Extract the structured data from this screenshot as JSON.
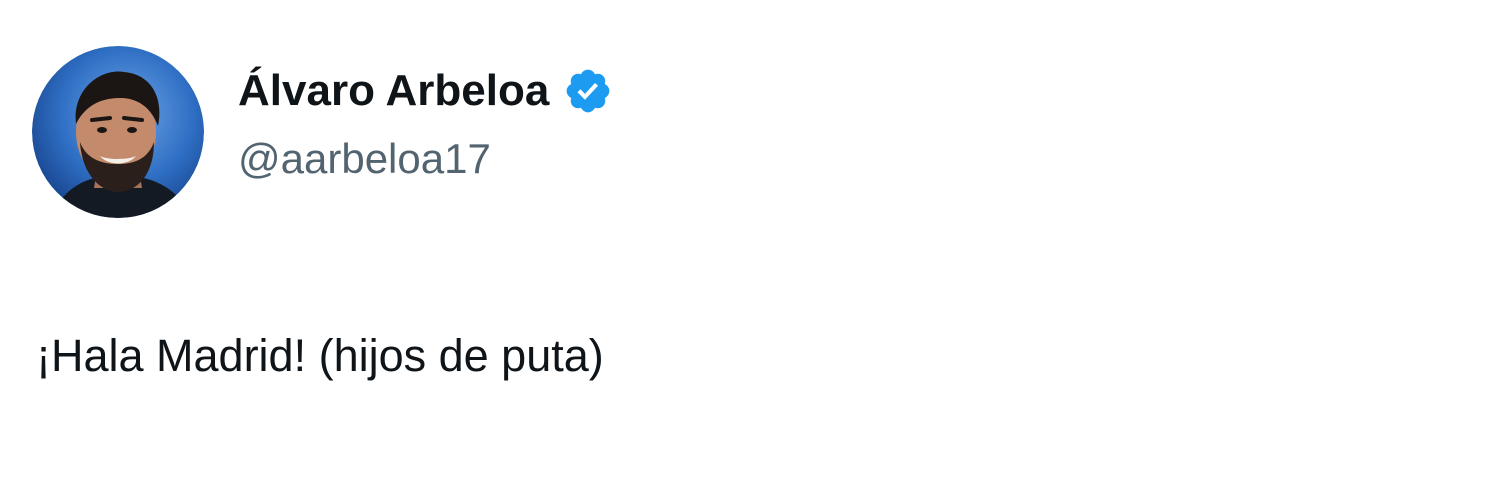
{
  "tweet": {
    "author": {
      "display_name": "Álvaro Arbeloa",
      "handle": "@aarbeloa17",
      "verified": true,
      "avatar_icon": "profile-photo"
    },
    "text": "¡Hala Madrid! (hijos de puta)"
  },
  "colors": {
    "name": "#0f1419",
    "handle": "#536471",
    "verified_badge": "#1d9bf0",
    "background": "#ffffff"
  }
}
